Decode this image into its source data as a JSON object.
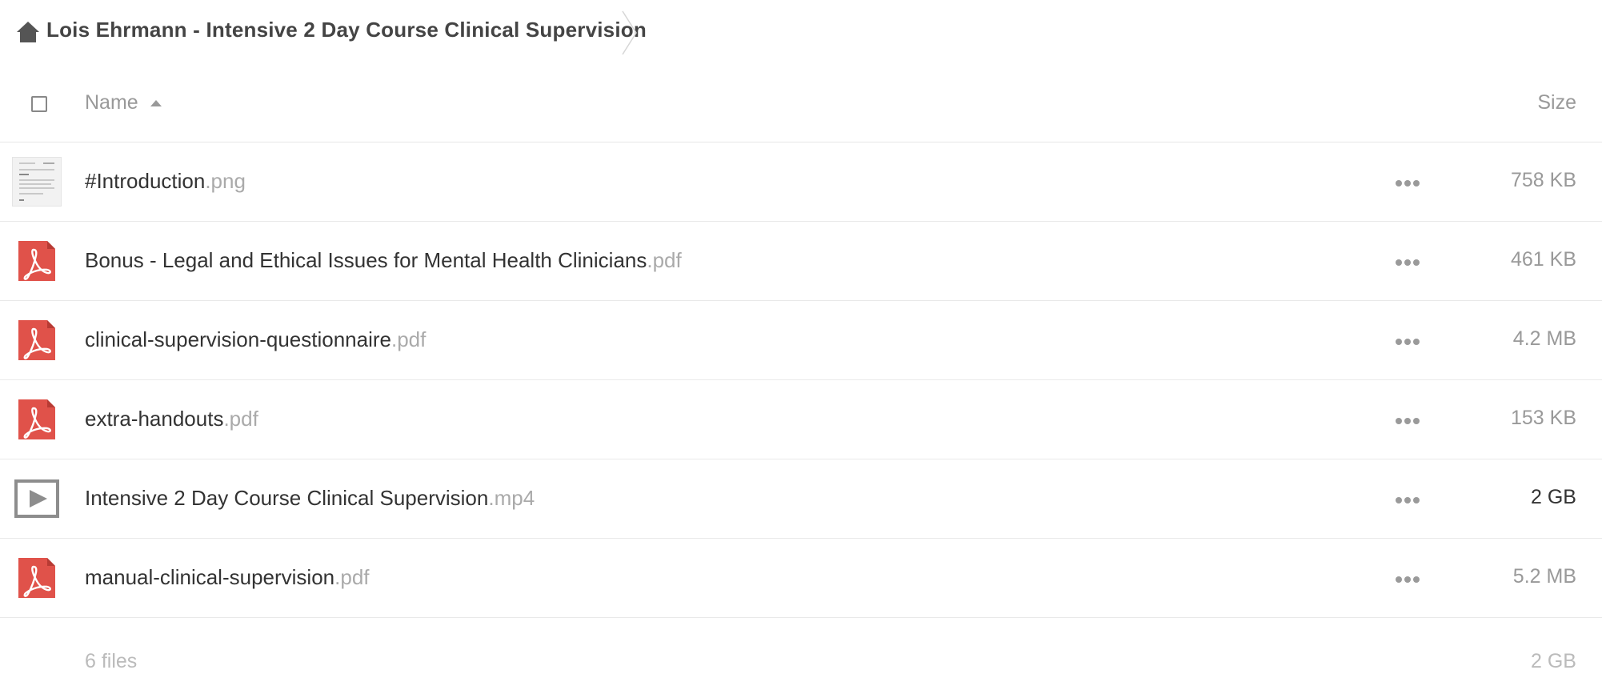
{
  "breadcrumb": {
    "home_icon": "home-icon",
    "title": "Lois Ehrmann - Intensive 2 Day Course Clinical Supervision"
  },
  "header": {
    "name_label": "Name",
    "size_label": "Size",
    "sort": "ascending"
  },
  "files": [
    {
      "base": "#Introduction",
      "ext": ".png",
      "size": "758 KB",
      "icon": "image-thumbnail"
    },
    {
      "base": "Bonus - Legal and Ethical Issues for Mental Health Clinicians",
      "ext": ".pdf",
      "size": "461 KB",
      "icon": "pdf-icon"
    },
    {
      "base": "clinical-supervision-questionnaire",
      "ext": ".pdf",
      "size": "4.2 MB",
      "icon": "pdf-icon"
    },
    {
      "base": "extra-handouts",
      "ext": ".pdf",
      "size": "153 KB",
      "icon": "pdf-icon"
    },
    {
      "base": "Intensive 2 Day Course Clinical Supervision",
      "ext": ".mp4",
      "size": "2 GB",
      "icon": "video-icon"
    },
    {
      "base": "manual-clinical-supervision",
      "ext": ".pdf",
      "size": "5.2 MB",
      "icon": "pdf-icon"
    }
  ],
  "footer": {
    "count": "6 files",
    "total_size": "2 GB"
  },
  "colors": {
    "pdf": "#e0524a",
    "muted": "#999999",
    "text": "#333333"
  }
}
